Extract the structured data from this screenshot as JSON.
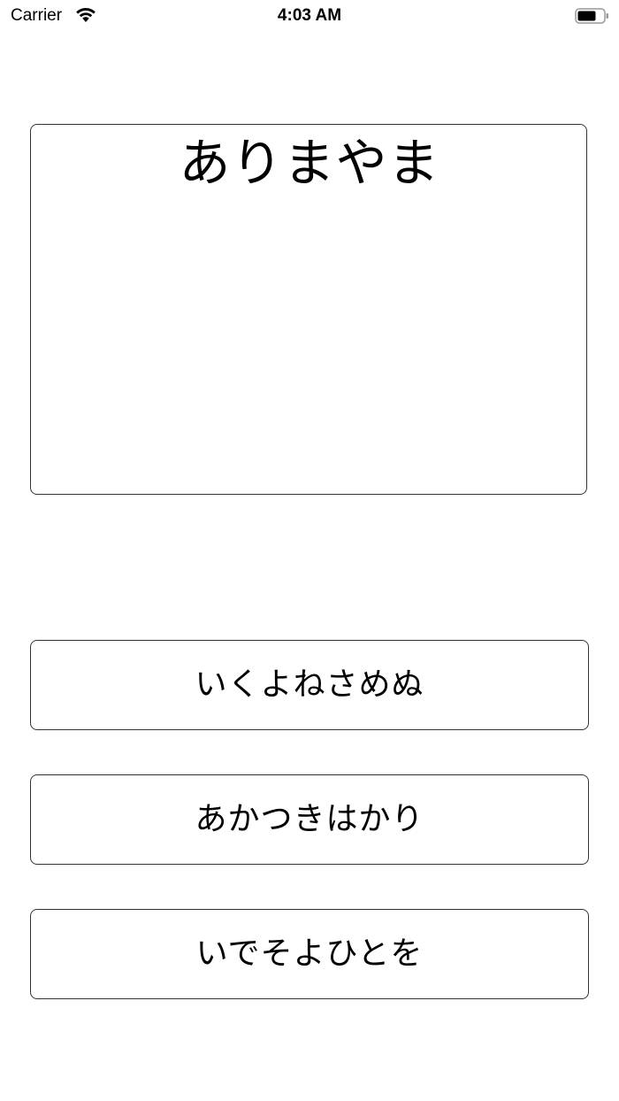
{
  "status_bar": {
    "carrier": "Carrier",
    "time": "4:03 AM",
    "wifi_icon": "wifi-icon",
    "battery_icon": "battery-icon"
  },
  "question": {
    "text": "ありまやま"
  },
  "answers": [
    {
      "label": "いくよねさめぬ"
    },
    {
      "label": "あかつきはかり"
    },
    {
      "label": "いでそよひとを"
    }
  ],
  "colors": {
    "background": "#ffffff",
    "border": "#333333",
    "text": "#000000"
  }
}
